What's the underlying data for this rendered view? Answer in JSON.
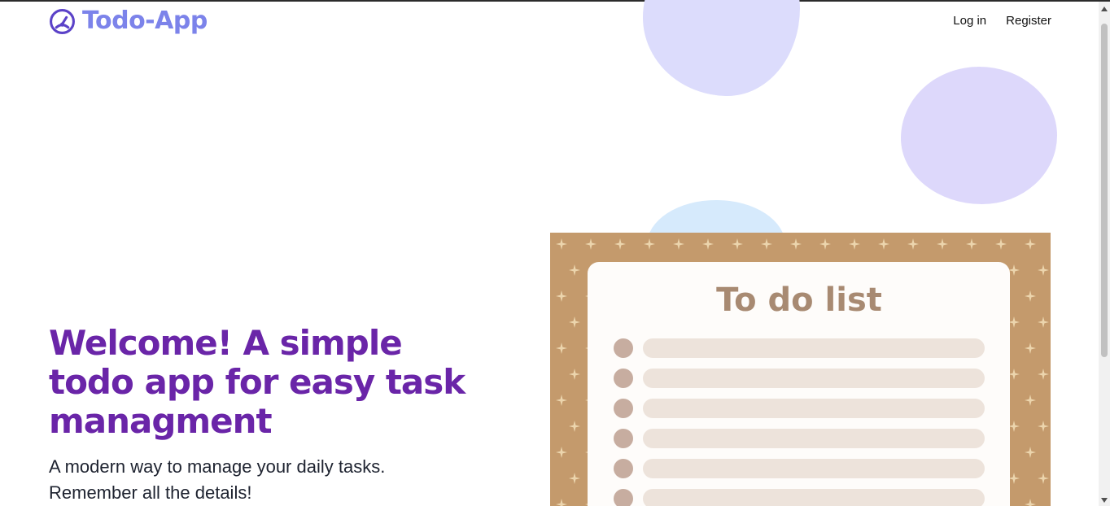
{
  "header": {
    "brand_name": "Todo-App",
    "brand_icon": "gauge-icon",
    "nav": {
      "login": "Log in",
      "register": "Register"
    }
  },
  "hero": {
    "title": "Welcome! A simple todo app for easy task managment",
    "subtitle": "A modern way to manage your daily tasks. Remember all the details!"
  },
  "illustration": {
    "heading": "To do list",
    "rows": 6
  },
  "colors": {
    "brand": "#7c83ea",
    "hero_title": "#6a25a8",
    "blob_lavender": "#dcdcfc",
    "blob_violet": "#ddd8fb",
    "blob_blue": "#d6eafc",
    "board_frame": "#c49a6c",
    "bullet": "#c7ada0",
    "line": "#ede3db"
  }
}
